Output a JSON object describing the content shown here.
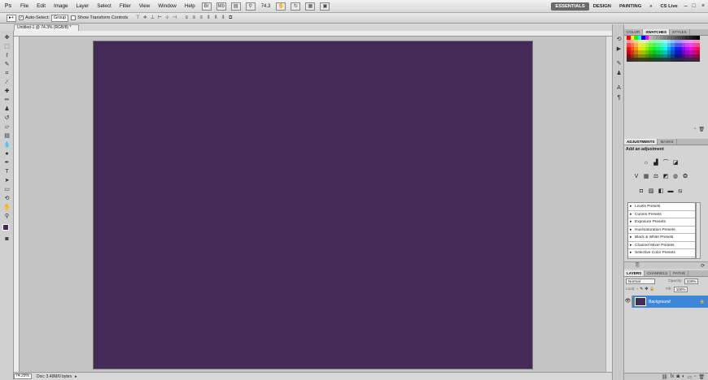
{
  "app": {
    "logo": "Ps"
  },
  "menu": [
    "File",
    "Edit",
    "Image",
    "Layer",
    "Select",
    "Filter",
    "View",
    "Window",
    "Help"
  ],
  "menubar_zoom": "74.3",
  "workspaces": {
    "essentials": "ESSENTIALS",
    "design": "DESIGN",
    "painting": "PAINTING",
    "more": "»",
    "cslive": "CS Live"
  },
  "options": {
    "auto_select_label": "Auto-Select:",
    "auto_select_value": "Group",
    "show_transform": "Show Transform Controls"
  },
  "document": {
    "tab_title": "Untitled-1 @ 74.3% (RGB/8) *",
    "canvas_color": "#442a56"
  },
  "status": {
    "zoom": "74.29%",
    "doc_info": "Doc: 3.49M/0 bytes"
  },
  "panels": {
    "swatches_tabs": [
      "COLOR",
      "SWATCHES",
      "STYLES"
    ],
    "adjustments_tabs": [
      "ADJUSTMENTS",
      "MASKS"
    ],
    "add_adjustment": "Add an adjustment",
    "presets": [
      "Levels Presets",
      "Curves Presets",
      "Exposure Presets",
      "Hue/Saturation Presets",
      "Black & White Presets",
      "Channel Mixer Presets",
      "Selective Color Presets"
    ],
    "layers_tabs": [
      "LAYERS",
      "CHANNELS",
      "PATHS"
    ],
    "blend_mode": "Normal",
    "opacity_label": "Opacity:",
    "opacity_value": "100%",
    "lock_label": "Lock:",
    "fill_label": "Fill:",
    "fill_value": "100%",
    "layer_name": "Background"
  },
  "icons": {
    "move_tool": "move-icon",
    "eye": "eye-icon",
    "lock": "lock-icon"
  }
}
